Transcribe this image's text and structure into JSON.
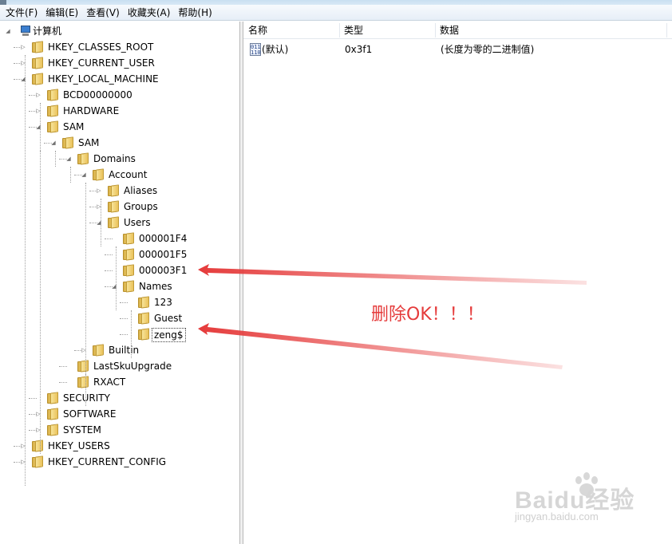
{
  "menu": [
    "文件(F)",
    "编辑(E)",
    "查看(V)",
    "收藏夹(A)",
    "帮助(H)"
  ],
  "tree": [
    {
      "label": "计算机",
      "kind": "computer",
      "expander": "expanded"
    },
    {
      "label": "HKEY_CLASSES_ROOT",
      "kind": "folder",
      "expander": "collapsed"
    },
    {
      "label": "HKEY_CURRENT_USER",
      "kind": "folder",
      "expander": "collapsed"
    },
    {
      "label": "HKEY_LOCAL_MACHINE",
      "kind": "folder",
      "expander": "expanded"
    },
    {
      "label": "BCD00000000",
      "kind": "folder",
      "expander": "collapsed"
    },
    {
      "label": "HARDWARE",
      "kind": "folder",
      "expander": "collapsed"
    },
    {
      "label": "SAM",
      "kind": "folder",
      "expander": "expanded"
    },
    {
      "label": "SAM",
      "kind": "folder",
      "expander": "expanded"
    },
    {
      "label": "Domains",
      "kind": "folder",
      "expander": "expanded"
    },
    {
      "label": "Account",
      "kind": "folder",
      "expander": "expanded"
    },
    {
      "label": "Aliases",
      "kind": "folder",
      "expander": "collapsed"
    },
    {
      "label": "Groups",
      "kind": "folder",
      "expander": "collapsed"
    },
    {
      "label": "Users",
      "kind": "folder",
      "expander": "expanded"
    },
    {
      "label": "000001F4",
      "kind": "folder",
      "expander": "none"
    },
    {
      "label": "000001F5",
      "kind": "folder",
      "expander": "none"
    },
    {
      "label": "000003F1",
      "kind": "folder",
      "expander": "none"
    },
    {
      "label": "Names",
      "kind": "folder",
      "expander": "expanded"
    },
    {
      "label": "123",
      "kind": "folder",
      "expander": "none"
    },
    {
      "label": "Guest",
      "kind": "folder",
      "expander": "none"
    },
    {
      "label": "zeng$",
      "kind": "folder",
      "expander": "none",
      "selected": true
    },
    {
      "label": "Builtin",
      "kind": "folder",
      "expander": "collapsed"
    },
    {
      "label": "LastSkuUpgrade",
      "kind": "folder",
      "expander": "none"
    },
    {
      "label": "RXACT",
      "kind": "folder",
      "expander": "none"
    },
    {
      "label": "SECURITY",
      "kind": "folder",
      "expander": "none"
    },
    {
      "label": "SOFTWARE",
      "kind": "folder",
      "expander": "collapsed"
    },
    {
      "label": "SYSTEM",
      "kind": "folder",
      "expander": "collapsed"
    },
    {
      "label": "HKEY_USERS",
      "kind": "folder",
      "expander": "collapsed"
    },
    {
      "label": "HKEY_CURRENT_CONFIG",
      "kind": "folder",
      "expander": "collapsed"
    }
  ],
  "list": {
    "columns": [
      "名称",
      "类型",
      "数据"
    ],
    "rows": [
      {
        "name": "(默认)",
        "type": "0x3f1",
        "data": "(长度为零的二进制值)",
        "icon": "binary-value-icon"
      }
    ]
  },
  "annotation": {
    "text": "删除OK！！！",
    "color": "#e53b3b"
  },
  "watermark": {
    "main": "Baidu经验",
    "sub": "jingyan.baidu.com"
  }
}
